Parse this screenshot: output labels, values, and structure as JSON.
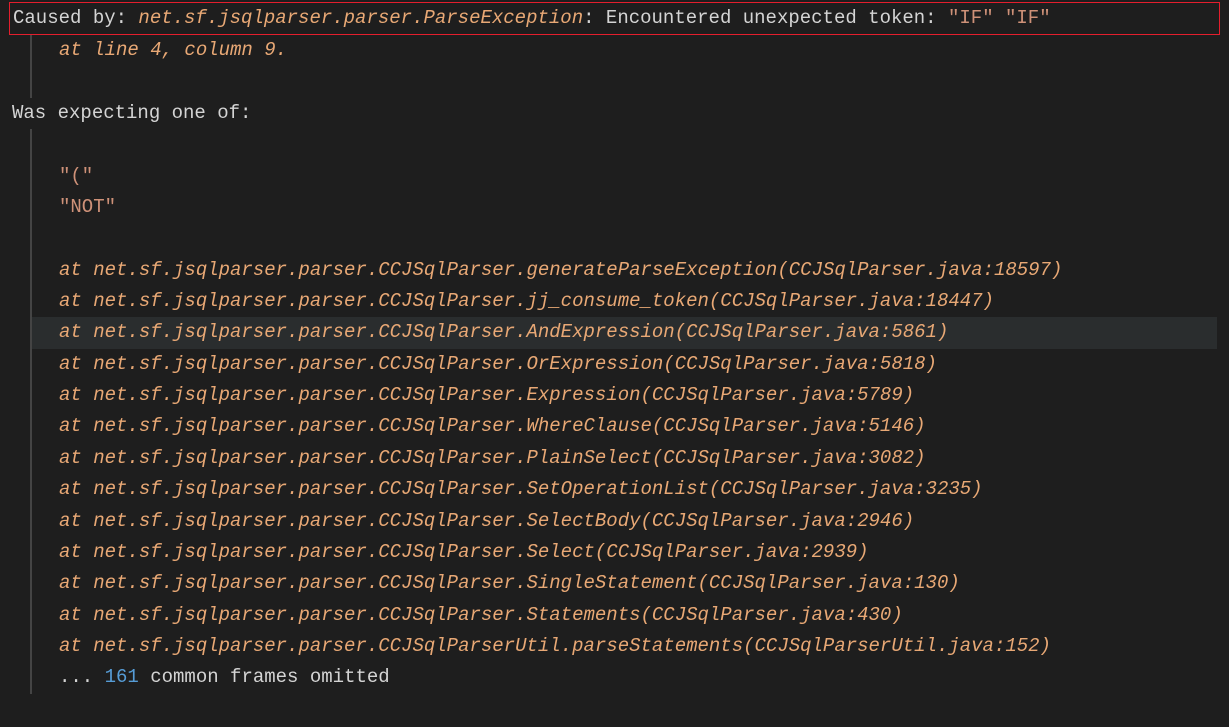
{
  "exception": {
    "caused_by_label": "Caused by: ",
    "exception_class": "net.sf.jsqlparser.parser.ParseException",
    "colon": ": ",
    "message_prefix": "Encountered unexpected token: ",
    "token1": "\"IF\"",
    "space": " ",
    "token2": "\"IF\"",
    "at_line": "at line 4, column 9.",
    "expecting": "Was expecting one of:",
    "literals": {
      "paren": "\"(\"",
      "not": "\"NOT\""
    },
    "stack": [
      "at net.sf.jsqlparser.parser.CCJSqlParser.generateParseException(CCJSqlParser.java:18597)",
      "at net.sf.jsqlparser.parser.CCJSqlParser.jj_consume_token(CCJSqlParser.java:18447)",
      "at net.sf.jsqlparser.parser.CCJSqlParser.AndExpression(CCJSqlParser.java:5861)",
      "at net.sf.jsqlparser.parser.CCJSqlParser.OrExpression(CCJSqlParser.java:5818)",
      "at net.sf.jsqlparser.parser.CCJSqlParser.Expression(CCJSqlParser.java:5789)",
      "at net.sf.jsqlparser.parser.CCJSqlParser.WhereClause(CCJSqlParser.java:5146)",
      "at net.sf.jsqlparser.parser.CCJSqlParser.PlainSelect(CCJSqlParser.java:3082)",
      "at net.sf.jsqlparser.parser.CCJSqlParser.SetOperationList(CCJSqlParser.java:3235)",
      "at net.sf.jsqlparser.parser.CCJSqlParser.SelectBody(CCJSqlParser.java:2946)",
      "at net.sf.jsqlparser.parser.CCJSqlParser.Select(CCJSqlParser.java:2939)",
      "at net.sf.jsqlparser.parser.CCJSqlParser.SingleStatement(CCJSqlParser.java:130)",
      "at net.sf.jsqlparser.parser.CCJSqlParser.Statements(CCJSqlParser.java:430)",
      "at net.sf.jsqlparser.parser.CCJSqlParserUtil.parseStatements(CCJSqlParserUtil.java:152)"
    ],
    "omitted_dots": "... ",
    "omitted_count": "161",
    "omitted_text": " common frames omitted"
  }
}
